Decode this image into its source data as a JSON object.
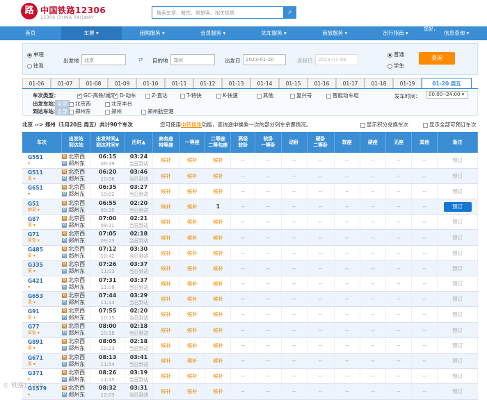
{
  "header": {
    "brand": "中国铁路12306",
    "brand_sub": "12306 CHINA RAILWAY",
    "search_placeholder": "搜索车票、餐饮、常旅客、相关规章"
  },
  "nav": [
    "首页",
    "车票 ▾",
    "团购服务 ▾",
    "会员服务 ▾",
    "站车服务 ▾",
    "商旅服务 ▾",
    "出行指南 ▾",
    "信息查询 ▾"
  ],
  "nav_user": "您好，",
  "query": {
    "one_way": "单程",
    "round_trip": "往返",
    "from_label": "出发地",
    "from_value": "北京",
    "to_label": "目的地",
    "to_value": "郑州",
    "depart_label": "出发日",
    "depart_value": "2023-01-20",
    "return_label": "返程日",
    "return_value": "2023-01-06",
    "normal": "普通",
    "student": "学生",
    "submit": "查询"
  },
  "dates": [
    "01-06",
    "01-07",
    "01-08",
    "01-09",
    "01-10",
    "01-11",
    "01-12",
    "01-13",
    "01-14",
    "01-15",
    "01-16",
    "01-17",
    "01-18",
    "01-19",
    "01-20 周五"
  ],
  "filters": {
    "type_label": "车次类型：",
    "types": [
      "GC-高铁/城际",
      "D-动车",
      "Z-直达",
      "T-特快",
      "K-快速",
      "其他",
      "复兴号",
      "智能动车组"
    ],
    "dep_label": "出发车站：",
    "dep_all": "全部",
    "dep_stations": [
      "北京西",
      "北京丰台"
    ],
    "arr_label": "到达车站：",
    "arr_all": "全部",
    "arr_stations": [
      "郑州东",
      "郑州",
      "郑州航空港"
    ],
    "time_label": "发车时间：",
    "time_value": "00:00--24:00"
  },
  "summary": {
    "route": "北京 --> 郑州（1月20日  周五）共计90个车次",
    "tip_pre": "您可使用",
    "tip_link": "中转换乘",
    "tip_post": "功能，查询途中换乘一次的部分列车余票情况。",
    "opt1": "显示积分兑换车次",
    "opt2": "显示全部可预订车次"
  },
  "columns": [
    "车次",
    "出发站\n到达站",
    "出发时间▲\n到达时间▼",
    "历时▲",
    "商务座\n特等座",
    "一等座",
    "二等座\n二等包座",
    "高级\n软卧",
    "软卧\n一等卧",
    "动卧",
    "硬卧\n二等卧",
    "软座",
    "硬座",
    "无座",
    "其他",
    "备注"
  ],
  "rows": [
    {
      "train": "G551",
      "tag": "",
      "from": "北京西",
      "to": "郑州东",
      "dep": "06:15",
      "arr": "09:39",
      "dur": "03:24",
      "day": "当日到达",
      "biz": "候补",
      "first": "候补",
      "second": "候补",
      "book": "预订"
    },
    {
      "train": "G511",
      "tag": "夏",
      "from": "北京西",
      "to": "郑州东",
      "dep": "06:20",
      "arr": "10:06",
      "dur": "03:46",
      "day": "当日到达",
      "biz": "候补",
      "first": "候补",
      "second": "候补",
      "book": "预订"
    },
    {
      "train": "G651",
      "tag": "",
      "from": "北京西",
      "to": "郑州东",
      "dep": "06:35",
      "arr": "10:02",
      "dur": "03:27",
      "day": "当日到达",
      "biz": "候补",
      "first": "候补",
      "second": "候补",
      "book": "预订"
    },
    {
      "train": "G51",
      "tag": "静夏",
      "from": "北京西",
      "to": "郑州东",
      "dep": "06:55",
      "arr": "09:15",
      "dur": "02:20",
      "day": "当日到达",
      "biz": "候补",
      "first": "候补",
      "second": "1",
      "book": "预订"
    },
    {
      "train": "G87",
      "tag": "夏",
      "from": "北京西",
      "to": "郑州东",
      "dep": "07:00",
      "arr": "09:21",
      "dur": "02:21",
      "day": "当日到达",
      "biz": "候补",
      "first": "候补",
      "second": "候补",
      "book": "预订"
    },
    {
      "train": "G71",
      "tag": "夏智",
      "from": "北京西",
      "to": "郑州东",
      "dep": "07:05",
      "arr": "09:23",
      "dur": "02:18",
      "day": "当日到达",
      "biz": "候补",
      "first": "候补",
      "second": "候补",
      "book": "预订"
    },
    {
      "train": "G485",
      "tag": "夏",
      "from": "北京西",
      "to": "郑州东",
      "dep": "07:12",
      "arr": "10:42",
      "dur": "03:30",
      "day": "当日到达",
      "biz": "候补",
      "first": "候补",
      "second": "候补",
      "book": "预订"
    },
    {
      "train": "G335",
      "tag": "夏",
      "from": "北京西",
      "to": "郑州东",
      "dep": "07:26",
      "arr": "11:03",
      "dur": "03:37",
      "day": "当日到达",
      "biz": "候补",
      "first": "候补",
      "second": "候补",
      "book": "预订"
    },
    {
      "train": "G421",
      "tag": "",
      "from": "北京西",
      "to": "郑州东",
      "dep": "07:31",
      "arr": "11:08",
      "dur": "03:37",
      "day": "当日到达",
      "biz": "候补",
      "first": "候补",
      "second": "候补",
      "book": "预订"
    },
    {
      "train": "G653",
      "tag": "夏",
      "from": "北京西",
      "to": "郑州东",
      "dep": "07:44",
      "arr": "11:13",
      "dur": "03:29",
      "day": "当日到达",
      "biz": "候补",
      "first": "候补",
      "second": "候补",
      "book": "预订"
    },
    {
      "train": "G91",
      "tag": "夏",
      "from": "北京西",
      "to": "郑州东",
      "dep": "07:55",
      "arr": "10:15",
      "dur": "02:20",
      "day": "当日到达",
      "biz": "候补",
      "first": "候补",
      "second": "候补",
      "book": "预订"
    },
    {
      "train": "G77",
      "tag": "夏智",
      "from": "北京西",
      "to": "郑州东",
      "dep": "08:00",
      "arr": "10:18",
      "dur": "02:18",
      "day": "当日到达",
      "biz": "候补",
      "first": "候补",
      "second": "候补",
      "book": "预订"
    },
    {
      "train": "G891",
      "tag": "夏",
      "from": "北京西",
      "to": "郑州东",
      "dep": "08:05",
      "arr": "10:23",
      "dur": "02:18",
      "day": "当日到达",
      "biz": "候补",
      "first": "候补",
      "second": "候补",
      "book": "预订"
    },
    {
      "train": "G671",
      "tag": "夏",
      "from": "北京西",
      "to": "郑州东",
      "dep": "08:13",
      "arr": "11:54",
      "dur": "03:41",
      "day": "当日到达",
      "biz": "候补",
      "first": "候补",
      "second": "候补",
      "book": "预订"
    },
    {
      "train": "G371",
      "tag": "",
      "from": "北京西",
      "to": "郑州东",
      "dep": "08:26",
      "arr": "11:45",
      "dur": "03:19",
      "day": "当日到达",
      "biz": "候补",
      "first": "候补",
      "second": "候补",
      "book": "预订"
    },
    {
      "train": "G1579",
      "tag": "",
      "from": "北京西",
      "to": "郑州东",
      "dep": "08:32",
      "arr": "12:03",
      "dur": "03:31",
      "day": "当日到达",
      "biz": "候补",
      "first": "候补",
      "second": "候补",
      "book": "预订"
    }
  ],
  "dash": "--",
  "watermark": "© 铁路12306"
}
